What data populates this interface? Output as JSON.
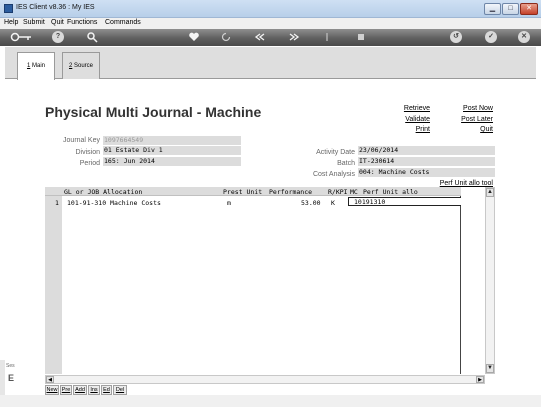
{
  "window": {
    "title": "IES Client v8.36 : My IES",
    "controls": {
      "minimize": "▁",
      "maximize": "□",
      "close": "✕"
    }
  },
  "menu": [
    "Help",
    "Submit",
    "Quit",
    "Functions",
    "Commands"
  ],
  "toolbar": {
    "icons": [
      "key-icon",
      "help-icon",
      "search-icon",
      "heart-icon",
      "refresh-icon",
      "rewind-icon",
      "fast-forward-icon",
      "upload-icon",
      "stop-icon",
      "back-icon",
      "check-icon",
      "close-icon"
    ],
    "glyphs": {
      "help": "?",
      "back": "↺",
      "check": "✓",
      "close": "✕"
    }
  },
  "tabs": [
    {
      "key": "1",
      "rest": " Main"
    },
    {
      "key": "2",
      "rest": " Source"
    }
  ],
  "page": {
    "title": "Physical Multi Journal - Machine",
    "actions_left": [
      "Retrieve",
      "Validate",
      "Print"
    ],
    "actions_right": [
      "Post Now",
      "Post Later",
      "Quit"
    ]
  },
  "fields": {
    "journal_key": {
      "label": "Journal Key",
      "value": "1097664549"
    },
    "division": {
      "label": "Division",
      "value": "01 Estate Div 1"
    },
    "period": {
      "label": "Period",
      "value": "165: Jun 2014"
    },
    "activity_date": {
      "label": "Activity Date",
      "value": "23/06/2014"
    },
    "batch": {
      "label": "Batch",
      "value": "IT-230614"
    },
    "cost_analysis": {
      "label": "Cost Analysis",
      "value": "004: Machine Costs"
    }
  },
  "perf_unit_link": "Perf Unit allo tool",
  "grid": {
    "columns": [
      "GL or JOB Allocation",
      "Prest Unit",
      "Performance",
      "R/KPI",
      "MC",
      "Perf Unit allo"
    ],
    "rows": [
      {
        "num": "1",
        "allocation": "101-91-310 Machine Costs",
        "prest_unit": "m",
        "performance": "53.00",
        "rkpi": "K",
        "mc": "",
        "perf_unit_allo": "10191310"
      }
    ]
  },
  "row_buttons": [
    "New",
    "Pre",
    "Add",
    "Ins",
    "Ed",
    "Del"
  ],
  "side": {
    "ses": "Ses",
    "e": "E"
  },
  "scroll": {
    "up": "▲",
    "down": "▼",
    "left": "◀",
    "right": "▶"
  }
}
